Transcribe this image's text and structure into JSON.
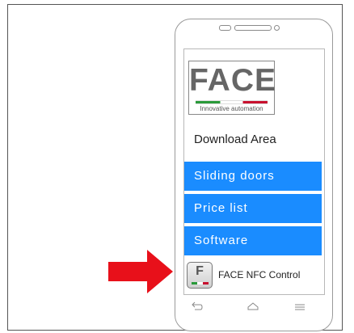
{
  "logo": {
    "name": "FACE",
    "tagline": "Innovative automation"
  },
  "page": {
    "heading": "Download Area"
  },
  "menu": [
    {
      "label": "Sliding doors"
    },
    {
      "label": "Price list"
    },
    {
      "label": "Software"
    }
  ],
  "app": {
    "icon_letter": "F",
    "label": "FACE NFC Control"
  },
  "navbar": {
    "icons": [
      "back-icon",
      "home-icon",
      "menu-icon"
    ]
  },
  "colors": {
    "button": "#1a8cff",
    "arrow": "#e8101a",
    "flag_green": "#2a9a3a",
    "flag_red": "#c8102e"
  }
}
